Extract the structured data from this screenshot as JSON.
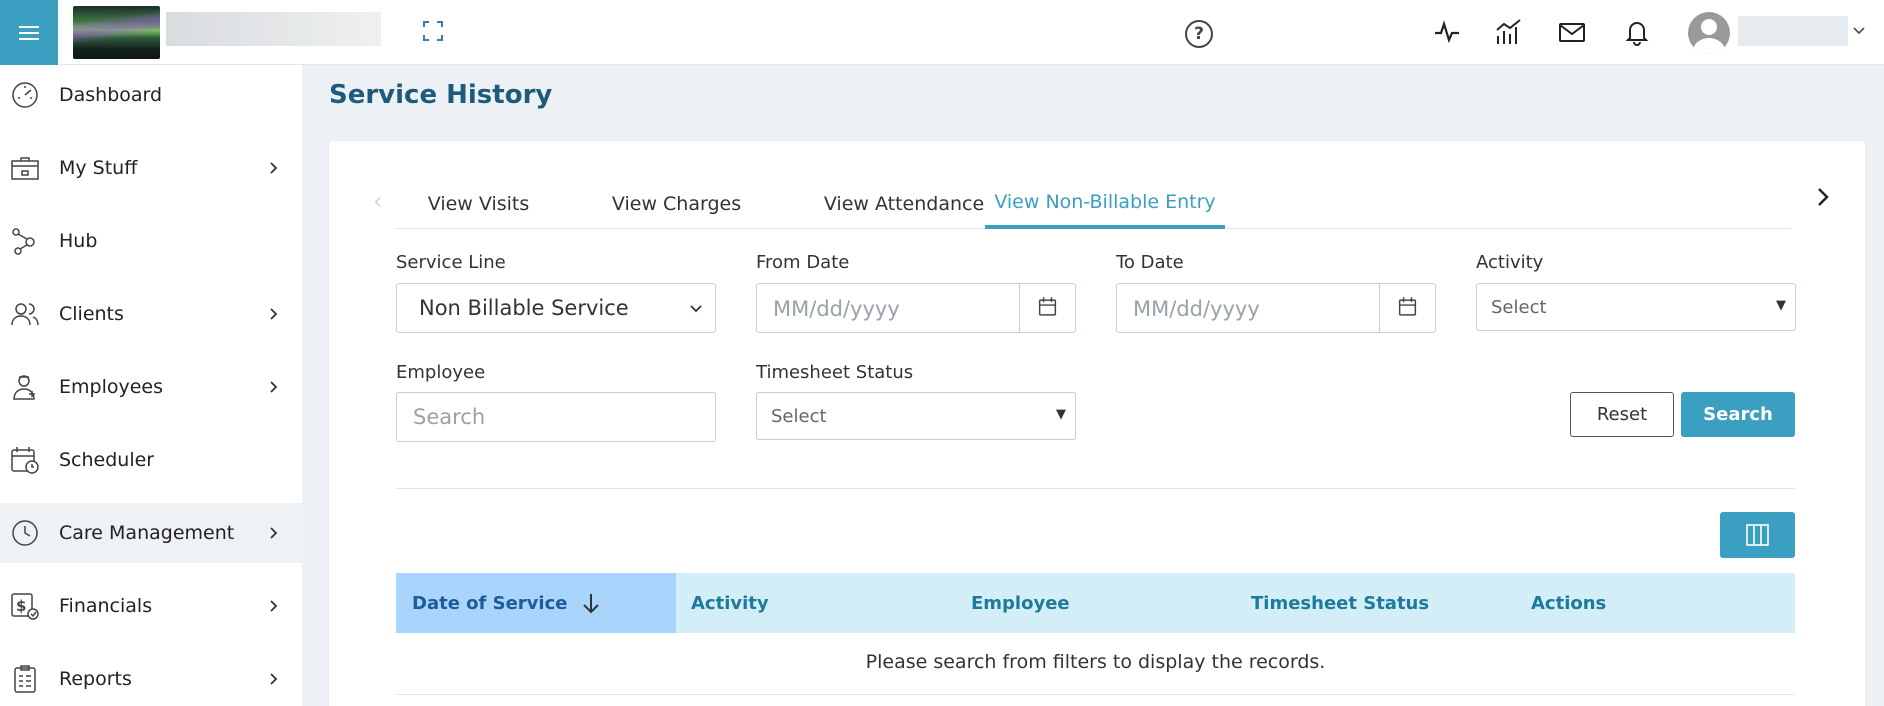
{
  "header": {
    "menu_icon": "hamburger-icon",
    "expand_icon": "fullscreen-icon",
    "help_glyph": "?",
    "icons": [
      "activity-icon",
      "analytics-icon",
      "mail-icon",
      "bell-icon"
    ]
  },
  "sidebar": {
    "items": [
      {
        "label": "Dashboard",
        "icon": "gauge-icon",
        "has_children": false
      },
      {
        "label": "My Stuff",
        "icon": "briefcase-icon",
        "has_children": true
      },
      {
        "label": "Hub",
        "icon": "hub-icon",
        "has_children": false
      },
      {
        "label": "Clients",
        "icon": "users-icon",
        "has_children": true
      },
      {
        "label": "Employees",
        "icon": "employee-icon",
        "has_children": true
      },
      {
        "label": "Scheduler",
        "icon": "calendar-clock-icon",
        "has_children": false
      },
      {
        "label": "Care Management",
        "icon": "clock-icon",
        "has_children": true,
        "active": true
      },
      {
        "label": "Financials",
        "icon": "dollar-icon",
        "has_children": true
      },
      {
        "label": "Reports",
        "icon": "report-icon",
        "has_children": true
      }
    ]
  },
  "page": {
    "title": "Service History"
  },
  "tabs": [
    {
      "label": "View Visits"
    },
    {
      "label": "View Charges"
    },
    {
      "label": "View Attendance"
    },
    {
      "label": "View Non-Billable Entry",
      "active": true
    }
  ],
  "filters": {
    "service_line": {
      "label": "Service Line",
      "value": "Non Billable Service"
    },
    "from_date": {
      "label": "From Date",
      "placeholder": "MM/dd/yyyy"
    },
    "to_date": {
      "label": "To Date",
      "placeholder": "MM/dd/yyyy"
    },
    "activity": {
      "label": "Activity",
      "value": "Select"
    },
    "employee": {
      "label": "Employee",
      "placeholder": "Search"
    },
    "timesheet_status": {
      "label": "Timesheet Status",
      "value": "Select"
    },
    "reset_label": "Reset",
    "search_label": "Search"
  },
  "table": {
    "columns": [
      "Date of Service",
      "Activity",
      "Employee",
      "Timesheet Status",
      "Actions"
    ],
    "sorted_column": "Date of Service",
    "empty_message": "Please search from filters to display the records."
  },
  "colors": {
    "accent": "#3a9fc0",
    "title": "#1e5b7a",
    "table_header": "#d3eef6",
    "sorted_header": "#a9d4fb"
  }
}
